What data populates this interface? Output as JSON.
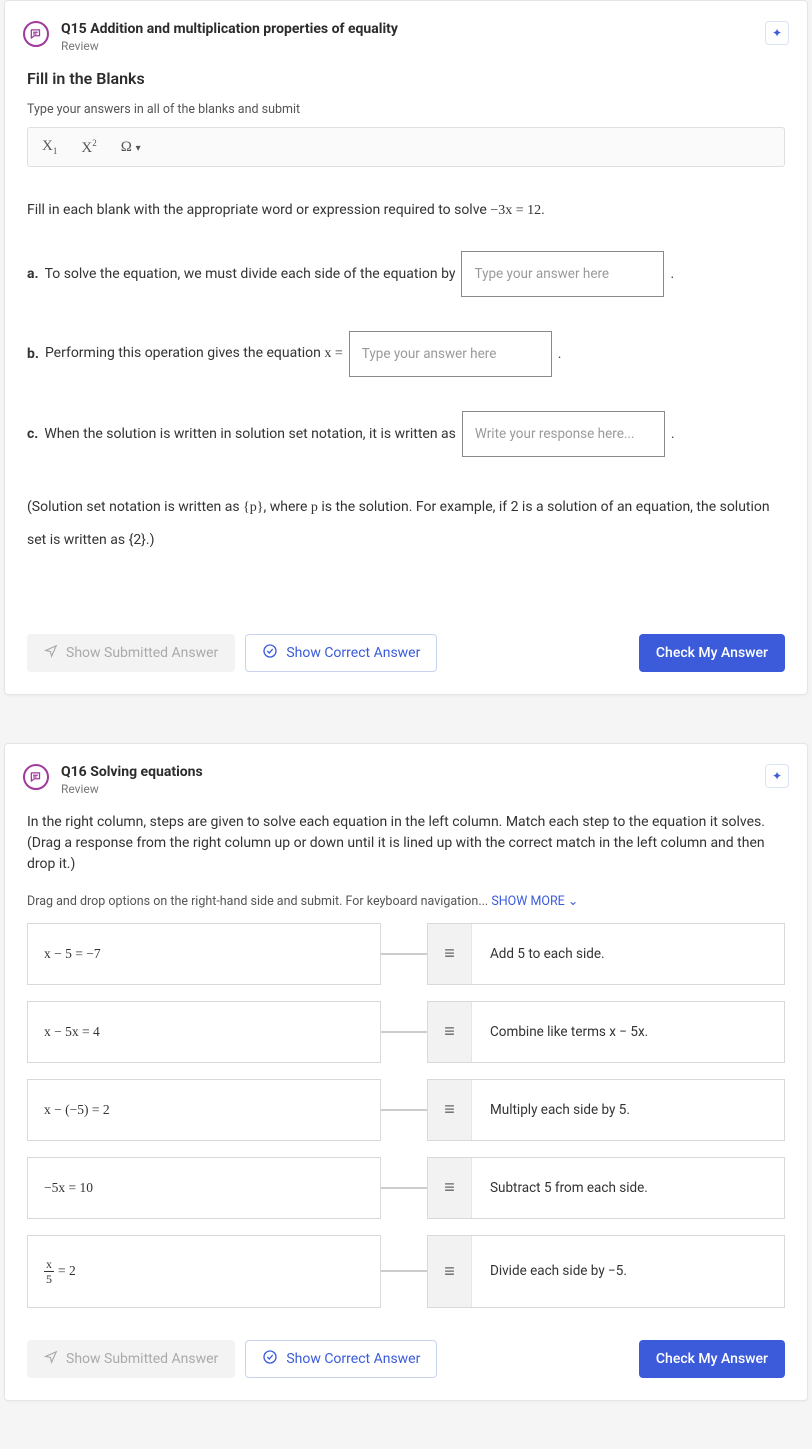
{
  "q15": {
    "title": "Q15 Addition and multiplication properties of equality",
    "subtitle": "Review",
    "section_title": "Fill in the Blanks",
    "instruction": "Type your answers in all of the blanks and submit",
    "toolbar": {
      "sub": "X",
      "sup": "X",
      "omega": "Ω"
    },
    "prompt_pre": "Fill in each blank with the appropriate word or expression required to solve ",
    "prompt_eq": "−3x = 12",
    "prompt_post": ".",
    "parts": {
      "a": {
        "label": "a.",
        "text": "To solve the equation, we must divide each side of the equation by",
        "placeholder": "Type your answer here",
        "tail": "."
      },
      "b": {
        "label": "b.",
        "text_pre": "Performing this operation gives the equation ",
        "text_eq": "x =",
        "placeholder": "Type your answer here",
        "tail": "."
      },
      "c": {
        "label": "c.",
        "text": "When the solution is written in solution set notation, it is written as",
        "placeholder": "Write your response here...",
        "tail": "."
      }
    },
    "hint_pre": "(Solution set notation is written as ",
    "hint_set": "{p}",
    "hint_mid": ", where ",
    "hint_p": "p",
    "hint_post": " is the solution. For example, if 2 is a solution of an equation, the solution set is written as {2}.)",
    "buttons": {
      "submitted": "Show Submitted Answer",
      "correct": "Show Correct Answer",
      "check": "Check My Answer"
    }
  },
  "q16": {
    "title": "Q16 Solving equations",
    "subtitle": "Review",
    "description": "In the right column, steps are given to solve each equation in the left column. Match each step to the equation it solves. (Drag a response from the right column up or down until it is lined up with the correct match in the left column and then drop it.)",
    "dd_instruction": "Drag and drop options on the right-hand side and submit. For keyboard navigation... ",
    "show_more": "SHOW MORE",
    "rows": [
      {
        "left": "x − 5 = −7",
        "right": "Add 5 to each side."
      },
      {
        "left": "x − 5x = 4",
        "right": "Combine like terms x − 5x."
      },
      {
        "left": "x − (−5) = 2",
        "right": "Multiply each side by 5."
      },
      {
        "left": "−5x = 10",
        "right": "Subtract 5 from each side."
      },
      {
        "left": "FRAC",
        "right": "Divide each side by −5."
      }
    ],
    "frac": {
      "num": "x",
      "den": "5",
      "tail": " = 2"
    },
    "buttons": {
      "submitted": "Show Submitted Answer",
      "correct": "Show Correct Answer",
      "check": "Check My Answer"
    }
  }
}
